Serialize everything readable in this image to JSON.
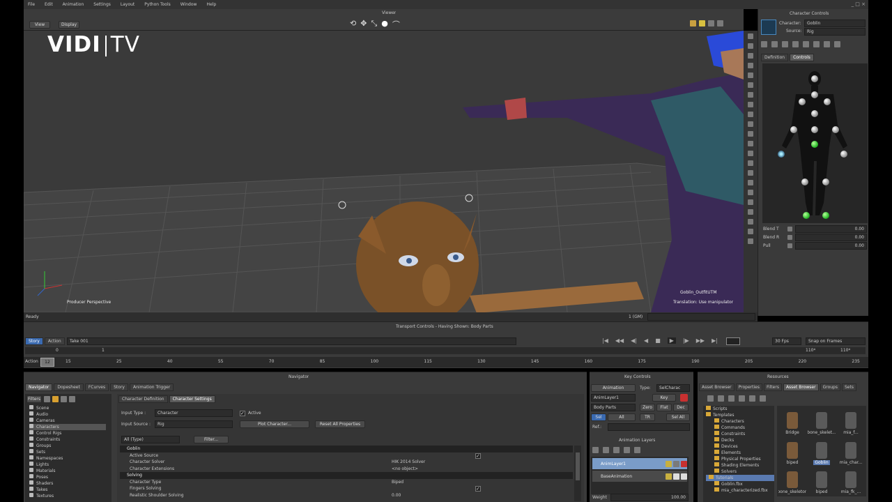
{
  "menu": [
    "File",
    "Edit",
    "Animation",
    "Settings",
    "Layout",
    "Python Tools",
    "Window",
    "Help"
  ],
  "viewer": {
    "title": "Viewer",
    "btn_view": "View",
    "btn_display": "Display",
    "camera_label": "Producer Perspective",
    "overlay_name": "Goblin_OutfitUTM",
    "overlay_mode": "Translation: Use manipulator",
    "watermark_left": "VIDI",
    "watermark_right": "TV"
  },
  "status": {
    "left": "Ready",
    "time": "1 (GM)"
  },
  "transport": {
    "title": "Transport Controls - Having Shown: Body Parts",
    "tab_story": "Story",
    "tab_action": "Action",
    "take": "Take 001",
    "fps": "30 Fps",
    "snap": "Snap on Frames",
    "start_val": "0",
    "frame_val": "1",
    "end_a": "110*",
    "end_b": "110*",
    "ruler_label": "Action",
    "ruler_ticks": [
      "15",
      "25",
      "40",
      "55",
      "70",
      "85",
      "100",
      "115",
      "130",
      "145",
      "160",
      "175",
      "190",
      "205",
      "220",
      "235"
    ],
    "current_frame": "12"
  },
  "character_controls": {
    "title": "Character Controls",
    "character_label": "Character:",
    "character_value": "Goblin",
    "source_label": "Source:",
    "source_value": "Rig",
    "tab_definition": "Definition",
    "tab_controls": "Controls",
    "blend1_label": "Blend T",
    "blend1_value": "0.00",
    "blend2_label": "Blend R",
    "blend2_value": "0.00",
    "pull_label": "Pull",
    "pull_value": "0.00"
  },
  "navigator": {
    "title": "Navigator",
    "tabs": [
      "Navigator",
      "Dopesheet",
      "FCurves",
      "Story",
      "Animation Trigger"
    ],
    "filters": "Filters",
    "tree": [
      "Scene",
      "Audio",
      "Cameras",
      "Characters",
      "Control Rigs",
      "Constraints",
      "Groups",
      "Sets",
      "Namespaces",
      "Lights",
      "Materials",
      "Poses",
      "Shaders",
      "Takes",
      "Textures"
    ],
    "selected_tree": "Characters",
    "sub_tabs": [
      "Character Definition",
      "Character Settings"
    ],
    "input_type_label": "Input Type :",
    "input_type_value": "Character",
    "active_label": "Active",
    "input_source_label": "Input Source :",
    "input_source_value": "Rig",
    "plot_btn": "Plot Character...",
    "reset_btn": "Reset All Properties",
    "filter_value": "All (Type)",
    "filter_btn": "Filter...",
    "props": [
      {
        "name": "Goblin",
        "val": "",
        "header": true
      },
      {
        "name": "Active Source",
        "val": "checkbox"
      },
      {
        "name": "Character Solver",
        "val": "HIK 2014 Solver"
      },
      {
        "name": "Character Extensions",
        "val": "<no object>"
      },
      {
        "name": "Solving",
        "val": "",
        "header": true
      },
      {
        "name": "Character Type",
        "val": "Biped"
      },
      {
        "name": "Fingers Solving",
        "val": "checkbox"
      },
      {
        "name": "Realistic Shoulder Solving",
        "val": "0.00"
      }
    ]
  },
  "key_controls": {
    "title": "Key Controls",
    "anim_btn": "Animation",
    "type_label": "Type:",
    "type_value": "SelCharac",
    "layer_value": "AnimLayer1",
    "key_btn": "Key",
    "body_parts": "Body Parts",
    "zero": "Zero",
    "flat": "Flat",
    "dec": "Dec",
    "sel": "Sel",
    "all": "All",
    "tr": "TR",
    "sel_all": "Sel All",
    "ref_label": "Ref.:",
    "anim_layers_title": "Animation Layers",
    "layers": [
      "AnimLayer1",
      "BaseAnimation"
    ],
    "weight_label": "Weight",
    "weight_value": "100.00"
  },
  "resources": {
    "title": "Resources",
    "tabs": [
      "Asset Browser",
      "Properties",
      "Filters",
      "Asset Browser",
      "Groups",
      "Sets"
    ],
    "tree": [
      "Scripts",
      "Templates",
      "Characters",
      "Commands",
      "Constraints",
      "Decks",
      "Devices",
      "Elements",
      "Physical Properties",
      "Shading Elements",
      "Solvers",
      "Tutorials",
      "Goblin.fbx",
      "mia_characterized.fbx"
    ],
    "selected_tree": "Tutorials",
    "assets": [
      "Bridge",
      "bone_skelet...",
      "mia_f...",
      "biped",
      "Goblin",
      "mia_char...",
      "bone_skeleton",
      "biped",
      "mia_fk_..."
    ],
    "selected_asset": "Goblin"
  }
}
